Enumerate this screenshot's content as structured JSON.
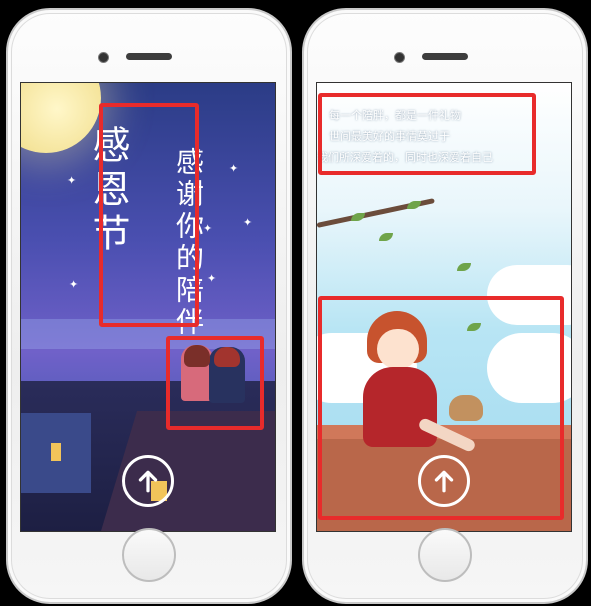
{
  "left": {
    "title_main": "感恩节",
    "title_sub": "感谢你的陪伴",
    "stars": [
      "✦",
      "✦",
      "✦",
      "✦",
      "✦",
      "✦"
    ],
    "button_icon": "arrow-up-icon"
  },
  "right": {
    "poem": [
      "每一个陪胖，都是一件礼物",
      "世间最美好的事情莫过于",
      "我们所深爱着的，同时也深爱着自己"
    ],
    "button_icon": "arrow-up-icon"
  },
  "colors": {
    "highlight": "#e82b2b"
  }
}
